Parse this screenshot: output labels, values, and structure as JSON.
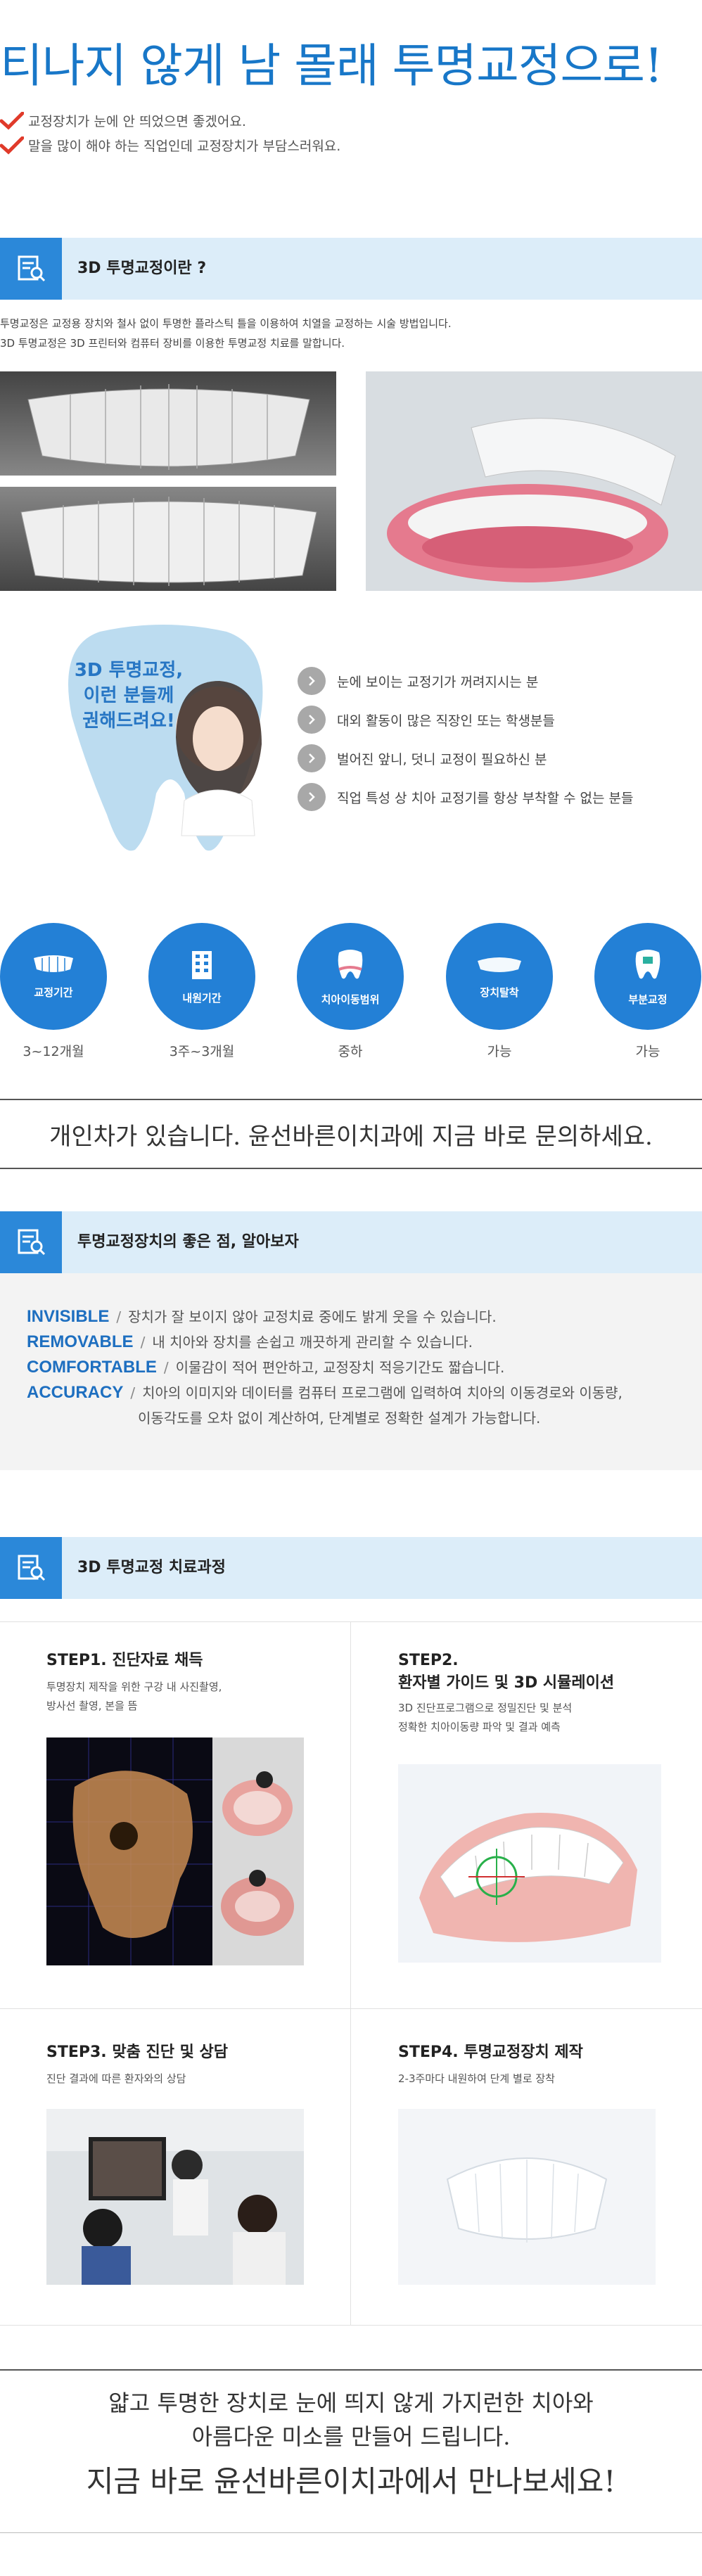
{
  "hero": {
    "title": "티나지 않게 남 몰래 투명교정으로!",
    "checks": [
      "교정장치가 눈에 안 띄었으면 좋겠어요.",
      "말을 많이 해야 하는 직업인데 교정장치가 부담스러워요."
    ]
  },
  "section1": {
    "label": "3D 투명교정이란 ?",
    "paragraphs": [
      "투명교정은 교정용 장치와 철사 없이 투명한 플라스틱 틀을 이용하여 치열을 교정하는 시술 방법입니다.",
      "3D 투명교정은 3D 프린터와 컴퓨터 장비를 이용한 투명교정 치료를 말합니다."
    ]
  },
  "recommend": {
    "tooth_lines": [
      "3D 투명교정,",
      "이런 분들께",
      "권해드려요!"
    ],
    "bullets": [
      "눈에 보이는 교정기가 꺼려지시는 분",
      "대외 활동이 많은 직장인 또는 학생분들",
      "벌어진 앞니, 덧니 교정이 필요하신 분",
      "직업 특성 상 치아 교정기를 항상 부착할 수 없는 분들"
    ]
  },
  "features": [
    {
      "label": "교정기간",
      "value": "3~12개월"
    },
    {
      "label": "내원기간",
      "value": "3주~3개월"
    },
    {
      "label": "치아이동범위",
      "value": "중하"
    },
    {
      "label": "장치탈착",
      "value": "가능"
    },
    {
      "label": "부분교정",
      "value": "가능"
    }
  ],
  "notice": "개인차가 있습니다. 윤선바른이치과에 지금 바로 문의하세요.",
  "section2": {
    "label": "투명교정장치의 좋은 점, 알아보자",
    "items": [
      {
        "key": "INVISIBLE",
        "text": "장치가 잘 보이지 않아 교정치료 중에도 밝게 웃을 수 있습니다."
      },
      {
        "key": "REMOVABLE",
        "text": "내 치아와 장치를 손쉽고 깨끗하게 관리할 수 있습니다."
      },
      {
        "key": "COMFORTABLE",
        "text": "이물감이 적어 편안하고, 교정장치 적응기간도 짧습니다."
      },
      {
        "key": "ACCURACY",
        "text": "치아의 이미지와 데이터를 컴퓨터 프로그램에 입력하여 치아의 이동경로와 이동량,"
      }
    ],
    "accuracy_cont": "이동각도를 오차 없이 계산하여, 단계별로 정확한 설계가 가능합니다."
  },
  "section3": {
    "label": "3D 투명교정 치료과정",
    "steps": [
      {
        "title": "STEP1. 진단자료 채득",
        "desc": [
          "투명장치 제작을 위한 구강 내 사진촬영,",
          "방사선 촬영, 본을 뜸"
        ]
      },
      {
        "title": "STEP2.",
        "title2": "환자별 가이드 및 3D 시뮬레이션",
        "desc": [
          "3D 진단프로그램으로 정밀진단 및 분석",
          "정확한 치아이동량 파악 및 결과 예측"
        ]
      },
      {
        "title": "STEP3. 맞춤 진단 및 상담",
        "desc": [
          "진단 결과에 따른 환자와의 상담"
        ]
      },
      {
        "title": "STEP4. 투명교정장치 제작",
        "desc": [
          "2-3주마다 내원하여 단계 별로 장착"
        ]
      }
    ]
  },
  "closing": {
    "line1": "얇고 투명한 장치로 눈에 띄지 않게 가지런한 치아와",
    "line2": "아름다운 미소를 만들어 드립니다.",
    "line3": "지금 바로 윤선바른이치과에서 만나보세요!"
  },
  "colors": {
    "brand_blue": "#2380d6",
    "bar_bg": "#dcedf9",
    "check_red": "#e03a2a"
  }
}
